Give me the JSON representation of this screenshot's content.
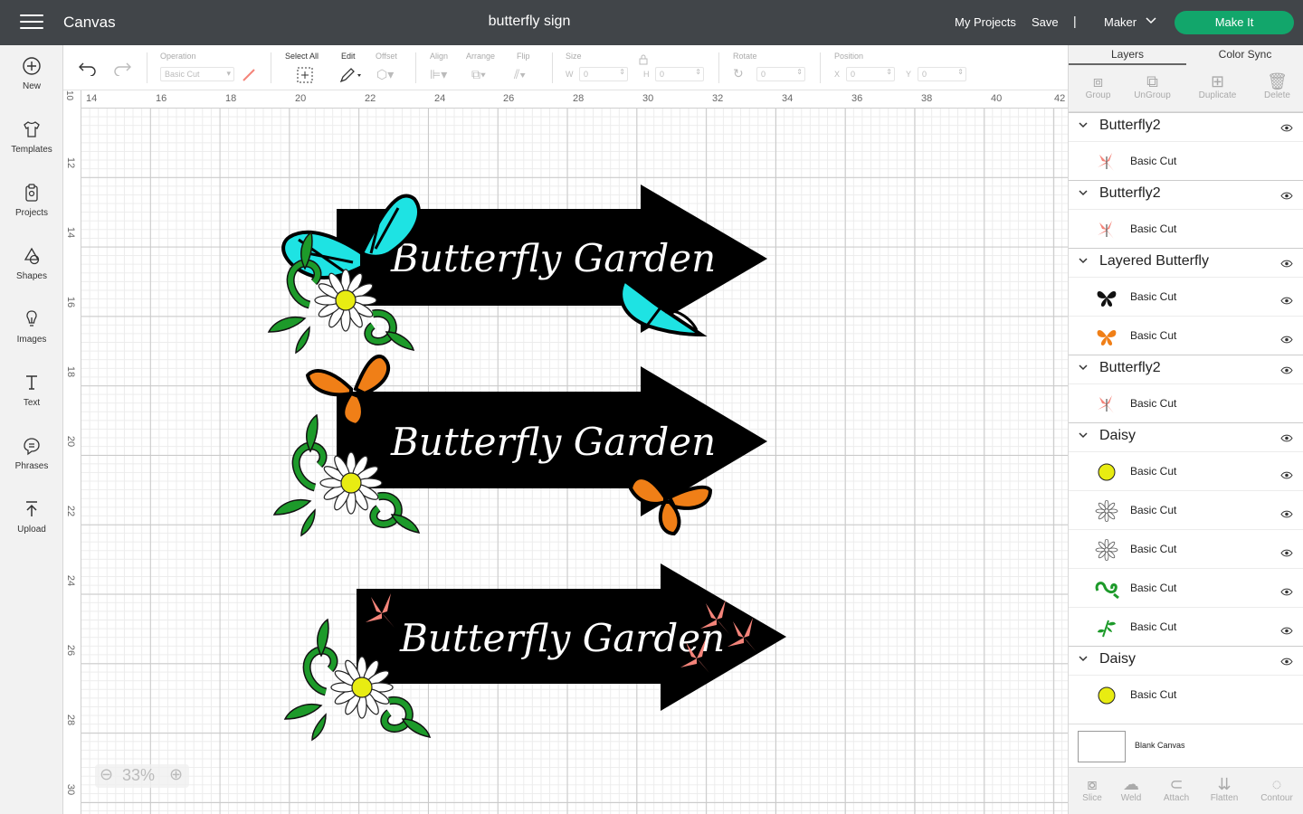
{
  "topbar": {
    "app_title": "Canvas",
    "doc_title": "butterfly sign",
    "my_projects": "My Projects",
    "save": "Save",
    "separator": "|",
    "machine": "Maker",
    "make_it": "Make It"
  },
  "leftrail": {
    "items": [
      {
        "label": "New",
        "icon": "plus-circle-icon"
      },
      {
        "label": "Templates",
        "icon": "shirt-icon"
      },
      {
        "label": "Projects",
        "icon": "clipboard-icon"
      },
      {
        "label": "Shapes",
        "icon": "shapes-icon"
      },
      {
        "label": "Images",
        "icon": "lightbulb-icon"
      },
      {
        "label": "Text",
        "icon": "text-icon"
      },
      {
        "label": "Phrases",
        "icon": "speech-icon"
      },
      {
        "label": "Upload",
        "icon": "upload-icon"
      }
    ]
  },
  "toolbar": {
    "operation_label": "Operation",
    "operation_value": "Basic Cut",
    "select_all": "Select All",
    "edit": "Edit",
    "offset": "Offset",
    "align": "Align",
    "arrange": "Arrange",
    "flip": "Flip",
    "size": "Size",
    "w": "W",
    "h": "H",
    "size_w": "0",
    "size_h": "0",
    "rotate": "Rotate",
    "rotate_value": "0",
    "position": "Position",
    "x": "X",
    "y": "Y",
    "pos_x": "0",
    "pos_y": "0"
  },
  "canvas": {
    "ruler_h": [
      "14",
      "16",
      "18",
      "20",
      "22",
      "24",
      "26",
      "28",
      "30",
      "32",
      "34",
      "36",
      "38",
      "40",
      "42"
    ],
    "ruler_h_start": "10",
    "ruler_v": [
      "12",
      "14",
      "16",
      "18",
      "20",
      "22",
      "24",
      "26",
      "28",
      "30"
    ],
    "zoom": "33%",
    "sign_text": "Butterfly Garden",
    "colors": {
      "sign": "#000000",
      "teal_wing": "#1ee3e3",
      "orange_wing": "#f07f17",
      "pink_butterfly": "#f4847a",
      "daisy_center": "#e8ec12",
      "leaf_green": "#1d9a2a"
    }
  },
  "rightpanel": {
    "tab_layers": "Layers",
    "tab_color_sync": "Color Sync",
    "actions": {
      "group": "Group",
      "ungroup": "UnGroup",
      "duplicate": "Duplicate",
      "delete": "Delete"
    },
    "groups": [
      {
        "title": "Butterfly2",
        "rows": [
          {
            "label": "Basic Cut",
            "thumb": "pink-butterfly"
          }
        ]
      },
      {
        "title": "Butterfly2",
        "rows": [
          {
            "label": "Basic Cut",
            "thumb": "pink-butterfly"
          }
        ]
      },
      {
        "title": "Layered Butterfly",
        "rows": [
          {
            "label": "Basic Cut",
            "thumb": "black-butterfly"
          },
          {
            "label": "Basic Cut",
            "thumb": "orange-butterfly"
          }
        ]
      },
      {
        "title": "Butterfly2",
        "rows": [
          {
            "label": "Basic Cut",
            "thumb": "pink-butterfly"
          }
        ]
      },
      {
        "title": "Daisy",
        "rows": [
          {
            "label": "Basic Cut",
            "thumb": "yellow-circle"
          },
          {
            "label": "Basic Cut",
            "thumb": "daisy-outline"
          },
          {
            "label": "Basic Cut",
            "thumb": "daisy-outline"
          },
          {
            "label": "Basic Cut",
            "thumb": "green-vine"
          },
          {
            "label": "Basic Cut",
            "thumb": "green-sprig"
          }
        ]
      },
      {
        "title": "Daisy",
        "rows": [
          {
            "label": "Basic Cut",
            "thumb": "yellow-circle"
          }
        ]
      }
    ],
    "blank_canvas": "Blank Canvas",
    "bottom": {
      "slice": "Slice",
      "weld": "Weld",
      "attach": "Attach",
      "flatten": "Flatten",
      "contour": "Contour"
    }
  }
}
